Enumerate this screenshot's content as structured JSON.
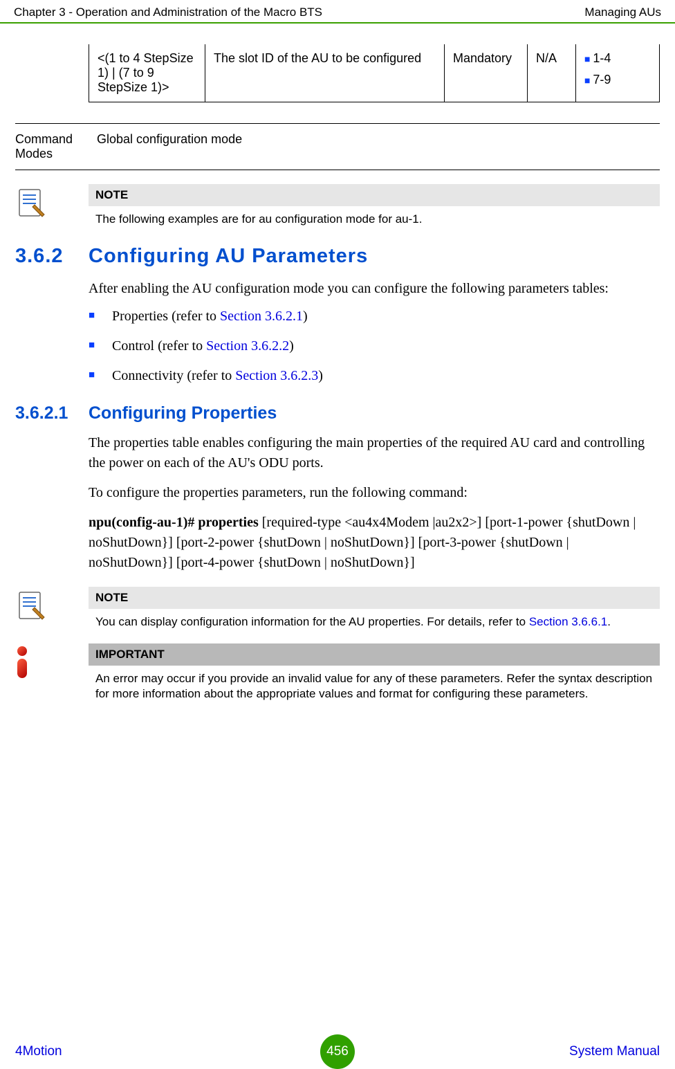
{
  "header": {
    "left": "Chapter 3 - Operation and Administration of the Macro BTS",
    "right": "Managing AUs"
  },
  "table_row": {
    "c1": "<(1 to 4 StepSize 1) | (7 to 9 StepSize 1)>",
    "c2": "The slot ID of the AU to be configured",
    "c3": "Mandatory",
    "c4": "N/A",
    "c5a": "1-4",
    "c5b": "7-9"
  },
  "command_modes": {
    "label": "Command Modes",
    "value": "Global configuration mode"
  },
  "note1": {
    "title": "NOTE",
    "text": "The following examples are for au configuration mode for au-1."
  },
  "sec362": {
    "num": "3.6.2",
    "title": "Configuring AU Parameters",
    "intro": "After enabling the AU configuration mode you can configure the following parameters tables:",
    "bullets": {
      "b1_pre": "Properties (refer to ",
      "b1_link": "Section 3.6.2.1",
      "b1_post": ")",
      "b2_pre": "Control (refer to ",
      "b2_link": "Section 3.6.2.2",
      "b2_post": ")",
      "b3_pre": "Connectivity (refer to ",
      "b3_link": "Section 3.6.2.3",
      "b3_post": ")"
    }
  },
  "sec3621": {
    "num": "3.6.2.1",
    "title": "Configuring Properties",
    "p1": "The properties table enables configuring the main properties of the required AU card and controlling the power on each of the AU's ODU ports.",
    "p2": "To configure the properties parameters, run the following command:",
    "cmd_bold": "npu(config-au-1)# properties",
    "cmd_rest": " [required-type <au4x4Modem |au2x2>] [port-1-power {shutDown | noShutDown}] [port-2-power {shutDown | noShutDown}] [port-3-power {shutDown | noShutDown}] [port-4-power {shutDown | noShutDown}]"
  },
  "note2": {
    "title": "NOTE",
    "text_pre": "You can display configuration information for the AU properties. For details, refer to ",
    "link": "Section 3.6.6.1",
    "text_post": "."
  },
  "important": {
    "title": "IMPORTANT",
    "text": "An error may occur if you provide an invalid value for any of these parameters. Refer the syntax description for more information about the appropriate values and format for configuring these parameters."
  },
  "footer": {
    "brand": "4Motion",
    "page": "456",
    "sysman": "System Manual"
  }
}
